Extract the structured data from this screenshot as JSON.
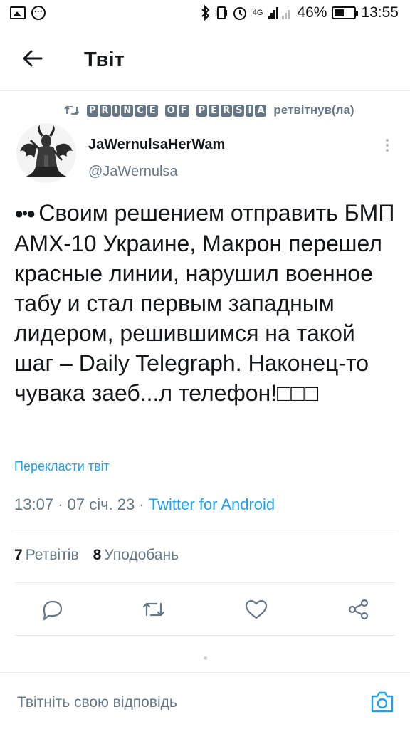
{
  "status_bar": {
    "network": "4G",
    "battery": "46%",
    "time": "13:55",
    "icons": [
      "image-icon",
      "chat-dots-icon",
      "bluetooth-icon",
      "alarm-icon",
      "signal-icon",
      "battery-icon"
    ]
  },
  "header": {
    "title": "Твіт",
    "back_icon": "arrow-left-icon"
  },
  "retweet_context": {
    "retweeter_letters": [
      "P",
      "R",
      "I",
      "N",
      "C",
      "E",
      " ",
      "O",
      "F",
      " ",
      "P",
      "E",
      "R",
      "S",
      "I",
      "A"
    ],
    "label": "ретвітнув(ла)"
  },
  "author": {
    "name": "JaWernulsaHerWam",
    "handle": "@JaWernulsa"
  },
  "tweet": {
    "text": "Своим решением отправить БМП AMX-10 Украине, Макрон перешел красные линии, нарушил военное табу и стал первым западным лидером, решившимся на такой шаг – Daily Telegraph. Наконец-то чувака заеб...л телефон!",
    "trailing_glyphs": "□□□",
    "translate_label": "Перекласти твіт",
    "time": "13:07",
    "date": "07 січ. 23",
    "source": "Twitter for Android"
  },
  "stats": {
    "retweets_count": "7",
    "retweets_label": "Ретвітів",
    "likes_count": "8",
    "likes_label": "Уподобань"
  },
  "reply": {
    "placeholder": "Твітніть свою відповідь"
  },
  "colors": {
    "accent": "#1da1f2",
    "secondary_text": "#657786",
    "divider": "#e6ecf0"
  }
}
